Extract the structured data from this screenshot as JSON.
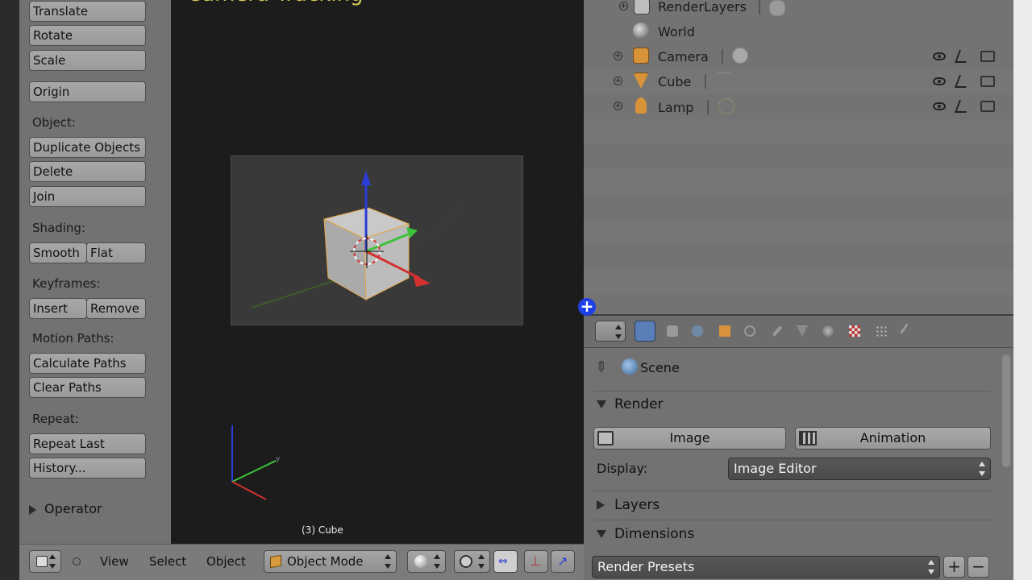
{
  "viewport": {
    "title": "Camera Tracking",
    "object_label": "(3) Cube"
  },
  "toolshelf": {
    "buttons": {
      "translate": "Translate",
      "rotate": "Rotate",
      "scale": "Scale",
      "origin": "Origin",
      "duplicate": "Duplicate Objects",
      "delete": "Delete",
      "join": "Join",
      "smooth": "Smooth",
      "flat": "Flat",
      "insert": "Insert",
      "remove": "Remove",
      "calculate_paths": "Calculate Paths",
      "clear_paths": "Clear Paths",
      "repeat_last": "Repeat Last",
      "history": "History..."
    },
    "sections": {
      "object": "Object:",
      "shading": "Shading:",
      "keyframes": "Keyframes:",
      "motion_paths": "Motion Paths:",
      "repeat": "Repeat:"
    },
    "operator": "Operator"
  },
  "view_header": {
    "menus": [
      "View",
      "Select",
      "Object"
    ],
    "mode": "Object Mode"
  },
  "outliner": {
    "items": [
      {
        "label": "RenderLayers"
      },
      {
        "label": "World"
      },
      {
        "label": "Camera"
      },
      {
        "label": "Cube"
      },
      {
        "label": "Lamp"
      }
    ]
  },
  "properties": {
    "context": "Scene",
    "render_panel": "Render",
    "image_button": "Image",
    "animation_button": "Animation",
    "display_label": "Display:",
    "display_value": "Image Editor",
    "layers_panel": "Layers",
    "dimensions_panel": "Dimensions",
    "render_presets": "Render Presets"
  },
  "colors": {
    "title_yellow": "#d6c95a",
    "split_cursor": "#1e3ee6",
    "cube_orange": "#d89a3a"
  }
}
